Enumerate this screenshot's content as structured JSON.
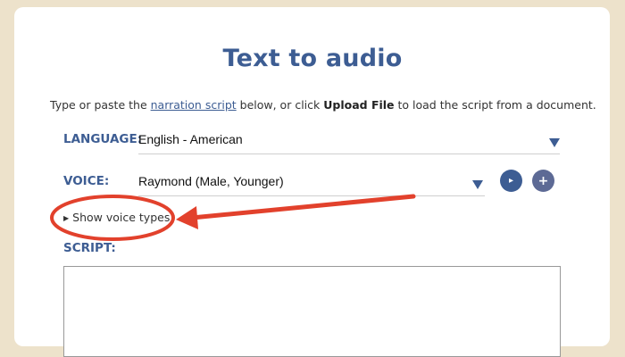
{
  "page": {
    "title": "Text to audio",
    "instructions": {
      "prefix": "Type or paste the ",
      "link": "narration script",
      "middle": " below, or click ",
      "bold": "Upload File",
      "suffix": " to load the script from a document."
    }
  },
  "language": {
    "label": "LANGUAGE:",
    "value": "English - American"
  },
  "voice": {
    "label": "VOICE:",
    "value": "Raymond (Male, Younger)",
    "play_button": "▸",
    "add_button": "+"
  },
  "voice_types_toggle": {
    "arrow": "▶",
    "label": "Show voice types"
  },
  "script": {
    "label": "SCRIPT:",
    "value": ""
  },
  "annotation": {
    "color": "#e2412c"
  }
}
